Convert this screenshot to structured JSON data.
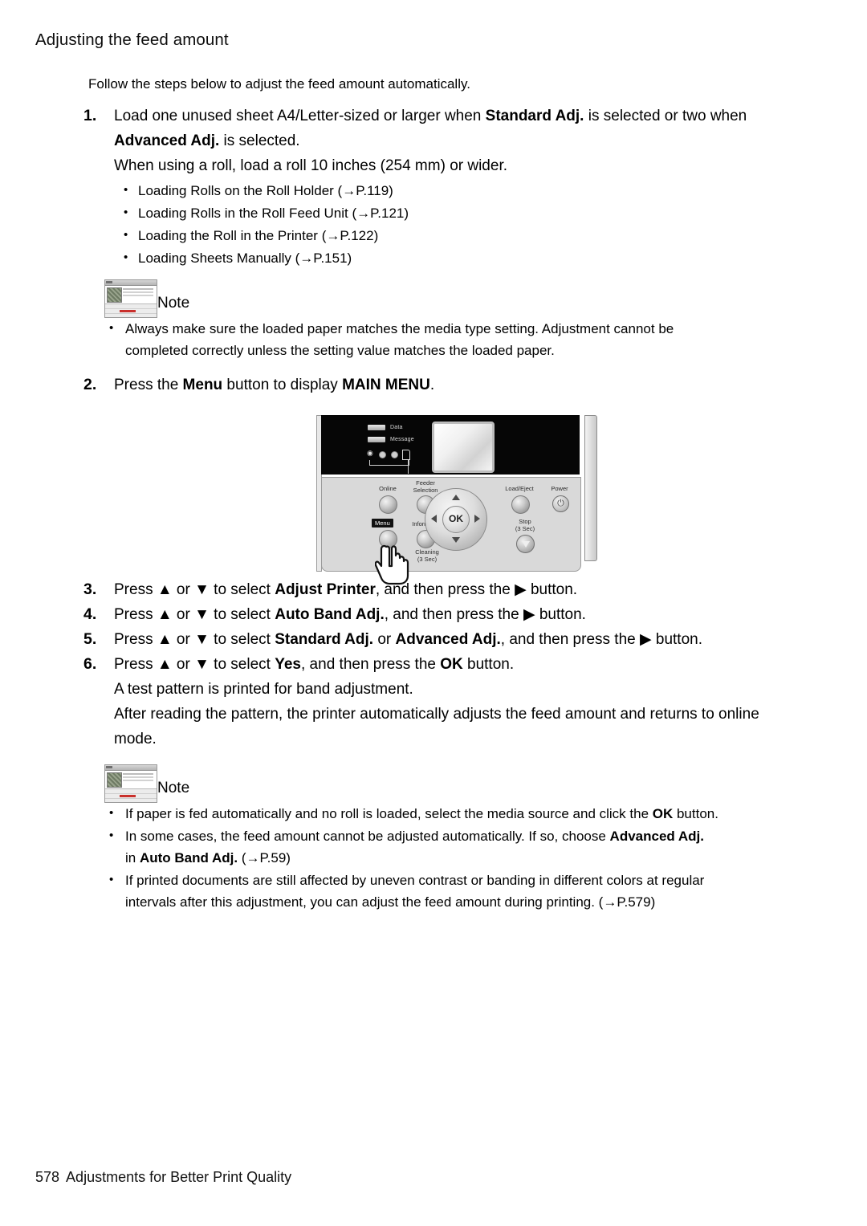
{
  "header": {
    "title": "Adjusting the feed amount"
  },
  "intro": "Follow the steps below to adjust the feed amount automatically.",
  "steps": [
    {
      "num": "1.",
      "line1_a": "Load one unused sheet A4/Letter-sized or larger when ",
      "line1_b": "Standard Adj.",
      "line1_c": " is selected or two when",
      "line2_a": "Advanced Adj.",
      "line2_b": " is selected.",
      "line3": "When using a roll, load a roll 10 inches (254 mm) or wider.",
      "sublist": [
        "Loading Rolls on the Roll Holder (→P.119)",
        "Loading Rolls in the Roll Feed Unit (→P.121)",
        "Loading the Roll in the Printer (→P.122)",
        "Loading Sheets Manually (→P.151)"
      ]
    },
    {
      "num": "2.",
      "a": "Press the ",
      "b": "Menu",
      "c": " button to display ",
      "d": "MAIN MENU",
      "e": "."
    },
    {
      "num": "3.",
      "a": "Press ▲ or ▼ to select ",
      "b": "Adjust Printer",
      "c": ", and then press the ▶ button."
    },
    {
      "num": "4.",
      "a": "Press ▲ or ▼ to select ",
      "b": "Auto Band Adj.",
      "c": ", and then press the ▶ button."
    },
    {
      "num": "5.",
      "a": "Press ▲ or ▼ to select ",
      "b": "Standard Adj.",
      "c": " or ",
      "d": "Advanced Adj.",
      "e": ", and then press the ▶ button."
    },
    {
      "num": "6.",
      "a": "Press ▲ or ▼ to select ",
      "b": "Yes",
      "c": ", and then press the ",
      "d": "OK",
      "e": " button.",
      "f": "A test pattern is printed for band adjustment.",
      "g": "After reading the pattern, the printer automatically adjusts the feed amount and returns to online",
      "h": "mode."
    }
  ],
  "note1": {
    "label": "Note",
    "items": [
      {
        "line1": "Always make sure the loaded paper matches the media type setting.  Adjustment cannot be",
        "line2": "completed correctly unless the setting value matches the loaded paper."
      }
    ]
  },
  "note2": {
    "label": "Note",
    "item1_a": "If paper is fed automatically and no roll is loaded, select the media source and click the ",
    "item1_b": "OK",
    "item1_c": " button.",
    "item2_a": "In some cases, the feed amount cannot be adjusted automatically.  If so, choose ",
    "item2_b": "Advanced Adj.",
    "item2_c": "in ",
    "item2_d": "Auto Band Adj.",
    "item2_e": " (→P.59)",
    "item3_a": "If printed documents are still affected by uneven contrast or banding in different colors at regular",
    "item3_b": "intervals after this adjustment, you can adjust the feed amount during printing. (→P.579)"
  },
  "figure": {
    "name": "printer-control-panel",
    "leds": [
      "Data",
      "Message"
    ],
    "buttons": {
      "online": "Online",
      "feeder_selection_l1": "Feeder",
      "feeder_selection_l2": "Selection",
      "menu": "Menu",
      "information": "Information",
      "cleaning_l1": "Cleaning",
      "cleaning_l2": "(3 Sec)",
      "load_eject": "Load/Eject",
      "power": "Power",
      "stop_l1": "Stop",
      "stop_l2": "(3 Sec)",
      "ok": "OK"
    }
  },
  "footer": {
    "page": "578",
    "section": "Adjustments for Better Print Quality"
  },
  "colors": {
    "page_bg": "#ffffff",
    "text": "#000000",
    "panel_dark": "#060606",
    "panel_light": "#d9d9d9"
  }
}
